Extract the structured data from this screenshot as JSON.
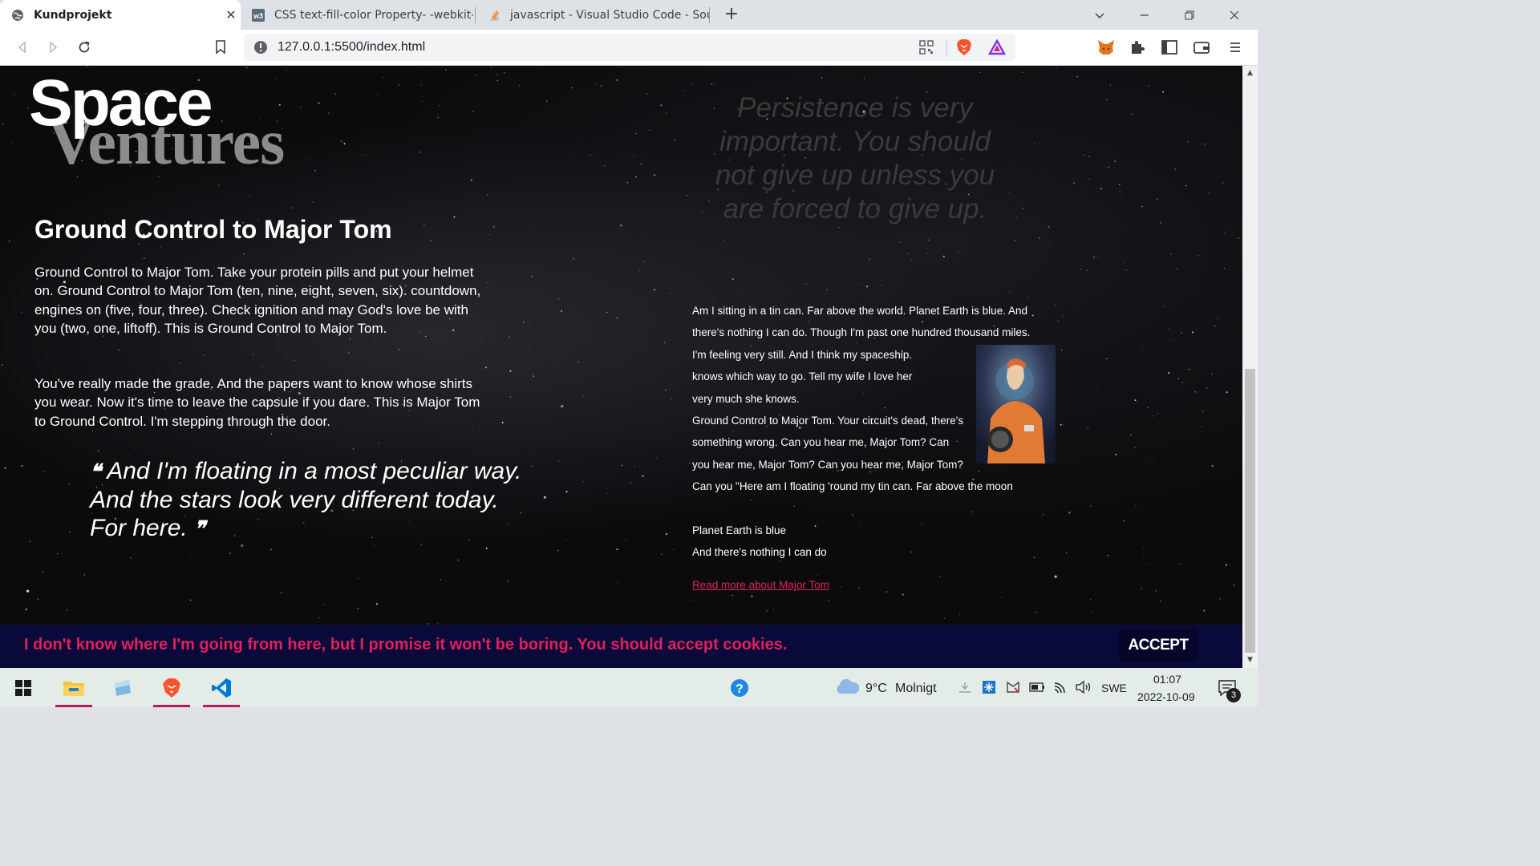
{
  "browser": {
    "tabs": [
      {
        "title": "Kundprojekt",
        "favicon": "globe-icon",
        "active": true
      },
      {
        "title": "CSS text-fill-color Property- -webkit-te",
        "favicon": "w3schools-icon",
        "active": false
      },
      {
        "title": "javascript - Visual Studio Code - Sourc",
        "favicon": "stackoverflow-icon",
        "active": false
      }
    ],
    "new_tab_label": "+",
    "url": "127.0.0.1:5500/index.html"
  },
  "page": {
    "logo": {
      "line1": "Space",
      "line2": "Ventures"
    },
    "heading": "Ground Control to Major Tom",
    "paragraph1": "Ground Control to Major Tom. Take your protein pills and put your helmet on. Ground Control to Major Tom (ten, nine, eight, seven, six). countdown, engines on (five, four, three). Check ignition and may God's love be with you (two, one, liftoff). This is Ground Control to Major Tom.",
    "paragraph2": "You've really made the grade. And the papers want to know whose shirts you wear. Now it's time to leave the capsule if you dare. This is Major Tom to Ground Control. I'm stepping through the door.",
    "quote": {
      "open_mark": "❝",
      "line1": "And I'm floating in a most peculiar way.",
      "line2": "And the stars look very different today.",
      "line3": "For here.",
      "close_mark": "❞"
    },
    "persistence_quote": "Persistence is very important. You should not give up unless you are forced to give up.",
    "lyrics": [
      "Am I sitting in a tin can. Far above the world. Planet Earth is blue. And",
      "there's nothing I can do. Though I'm past one hundred thousand miles.",
      "I'm feeling very still. And I think my spaceship.",
      "knows which way to go. Tell my wife I love her",
      "very much she knows.",
      "Ground Control to Major Tom. Your circuit's dead, there's",
      "something wrong. Can you hear me, Major Tom? Can",
      "you hear me, Major Tom? Can you hear me, Major Tom?",
      "Can you \"Here am I floating 'round my tin can. Far above the moon",
      "",
      "Planet Earth is blue",
      "And there's nothing I can do"
    ],
    "read_more": "Read more about Major Tom",
    "cookie": {
      "text": "I don't know where I'm going from here, but I promise it won't be boring. You should accept cookies.",
      "accept_label": "ACCEPT"
    }
  },
  "taskbar": {
    "weather": {
      "temp": "9°C",
      "condition": "Molnigt"
    },
    "language": "SWE",
    "time": "01:07",
    "date": "2022-10-09",
    "notification_count": "3"
  },
  "colors": {
    "accent_pink": "#e0205e",
    "cookie_bg": "#0a0a3a",
    "page_bg": "#0b0b0d",
    "quote_gray": "#3a3a3a"
  }
}
